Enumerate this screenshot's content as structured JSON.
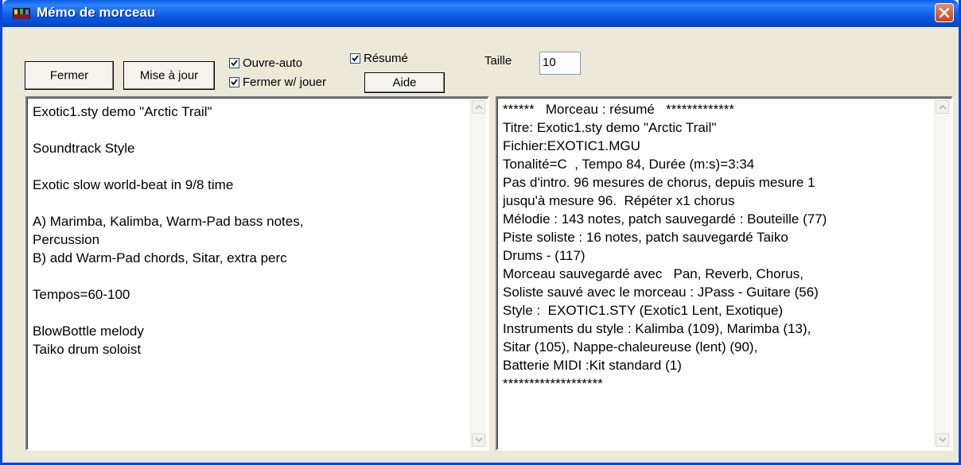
{
  "window": {
    "title": "Mémo de morceau"
  },
  "toolbar": {
    "close_button": "Fermer",
    "update_button": "Mise à jour",
    "help_button": "Aide",
    "size_label": "Taille",
    "size_value": "10"
  },
  "checkboxes": {
    "auto_open": {
      "label": "Ouvre-auto",
      "checked": true
    },
    "close_on_play": {
      "label": "Fermer w/ jouer",
      "checked": true
    },
    "summary": {
      "label": "Résumé",
      "checked": true
    }
  },
  "memo_left": {
    "text": "Exotic1.sty demo \"Arctic Trail\"\n\nSoundtrack Style\n\nExotic slow world-beat in 9/8 time\n\nA) Marimba, Kalimba, Warm-Pad bass notes,\nPercussion\nB) add Warm-Pad chords, Sitar, extra perc\n\nTempos=60-100\n\nBlowBottle melody\nTaiko drum soloist"
  },
  "memo_right": {
    "text": "******   Morceau : résumé   *************\nTitre: Exotic1.sty demo \"Arctic Trail\"\nFichier:EXOTIC1.MGU\nTonalité=C  , Tempo 84, Durée (m:s)=3:34\nPas d'intro. 96 mesures de chorus, depuis mesure 1\njusqu'à mesure 96.  Répéter x1 chorus\nMélodie : 143 notes, patch sauvegardé : Bouteille (77)\nPiste soliste : 16 notes, patch sauvegardé Taiko\nDrums - (117)\nMorceau sauvegardé avec   Pan, Reverb, Chorus,\nSoliste sauvé avec le morceau : JPass - Guitare (56)\nStyle :  EXOTIC1.STY (Exotic1 Lent, Exotique)\nInstruments du style : Kalimba (109), Marimba (13),\nSitar (105), Nappe-chaleureuse (lent) (90),\nBatterie MIDI :Kit standard (1)\n*******************"
  },
  "icons": {
    "app": "band-icon",
    "close": "close-x-icon",
    "scroll_up": "chevron-up-icon",
    "scroll_down": "chevron-down-icon"
  },
  "colors": {
    "titlebar": "#0a5ce4",
    "close": "#d2401c",
    "background": "#ece9d8"
  }
}
